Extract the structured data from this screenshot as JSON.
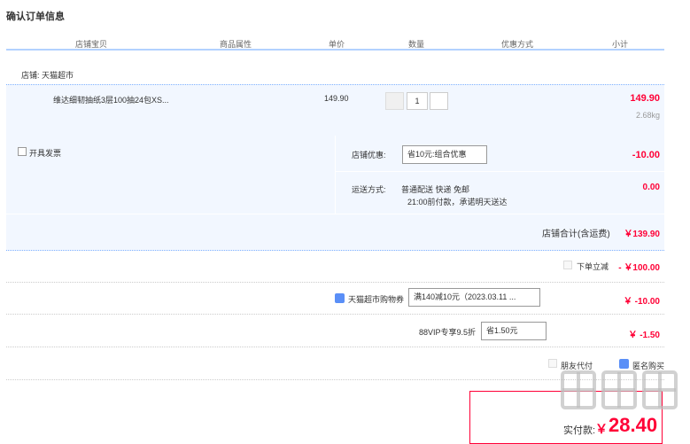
{
  "page_title": "确认订单信息",
  "columns": [
    "店铺宝贝",
    "商品属性",
    "单价",
    "数量",
    "优惠方式",
    "小计"
  ],
  "store": {
    "label": "店铺: 天猫超市"
  },
  "item": {
    "name": "维达细韧抽纸3层100抽24包XS...",
    "unit_price": "149.90",
    "quantity": "1",
    "subtotal": "149.90",
    "weight": "2.68kg"
  },
  "invoice": {
    "label": "开具发票"
  },
  "shop_discount": {
    "label": "店铺优惠:",
    "selected": "省10元:组合优惠",
    "amount": "-10.00"
  },
  "shipping": {
    "label": "运送方式:",
    "method": "普通配送 快递 免邮",
    "note": "21:00前付款，承诺明天送达",
    "amount": "0.00"
  },
  "store_total": {
    "label": "店铺合计(含运费)",
    "amount": "￥139.90"
  },
  "instant_discount": {
    "label": "下单立减",
    "amount": "- ￥100.00"
  },
  "tmall_coupon": {
    "label": "天猫超市购物券",
    "selected": "满140减10元（2023.03.11 ...",
    "amount": "￥ -10.00"
  },
  "vip": {
    "label": "88VIP专享9.5折",
    "selected": "省1.50元",
    "amount": "￥ -1.50"
  },
  "friend_pay": {
    "label": "朋友代付"
  },
  "anonymous": {
    "label": "匿名购买"
  },
  "payment": {
    "label": "实付款:",
    "currency": "￥",
    "amount": "28.40"
  },
  "colors": {
    "accent_red": "#ff0036",
    "header_blue": "#b2d1ff",
    "row_bg": "#f2f7ff",
    "checkbox_blue": "#5a8ff7"
  }
}
